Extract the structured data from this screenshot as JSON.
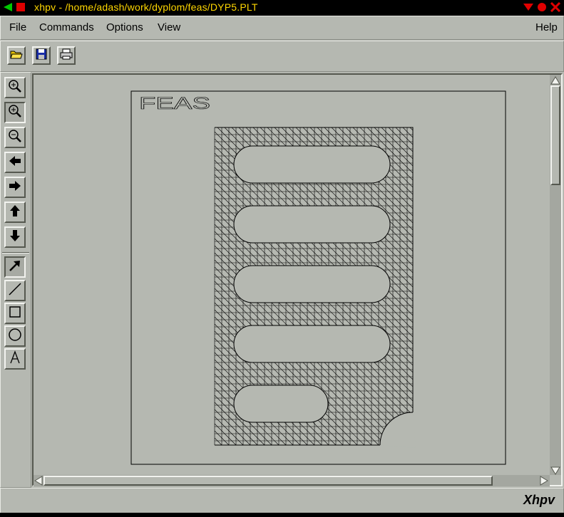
{
  "window": {
    "title": "xhpv - /home/adash/work/dyplom/feas/DYP5.PLT",
    "controls": [
      "back-icon",
      "stop-icon",
      "minimize-icon",
      "maximize-icon",
      "close-icon"
    ]
  },
  "menubar": {
    "file": "File",
    "commands": "Commands",
    "options": "Options",
    "view": "View",
    "help": "Help"
  },
  "toolbar": {
    "icons": [
      "open-folder-icon",
      "save-disk-icon",
      "print-icon"
    ]
  },
  "sidebar": {
    "tools": [
      "zoom-in-icon",
      "zoom-window-icon",
      "zoom-out-icon",
      "pan-left-icon",
      "pan-right-icon",
      "pan-up-icon",
      "pan-down-icon",
      "select-arrow-icon",
      "line-tool-icon",
      "rectangle-tool-icon",
      "circle-tool-icon",
      "text-tool-icon"
    ],
    "pressed": [
      "zoom-window-icon",
      "select-arrow-icon"
    ]
  },
  "drawing": {
    "logo_text": "FEAS"
  },
  "status": {
    "brand": "Xhpv"
  },
  "colors": {
    "titlebar_bg": "#000000",
    "title_text": "#ffd700",
    "panel": "#b5b8b1",
    "mesh": "#000000"
  }
}
